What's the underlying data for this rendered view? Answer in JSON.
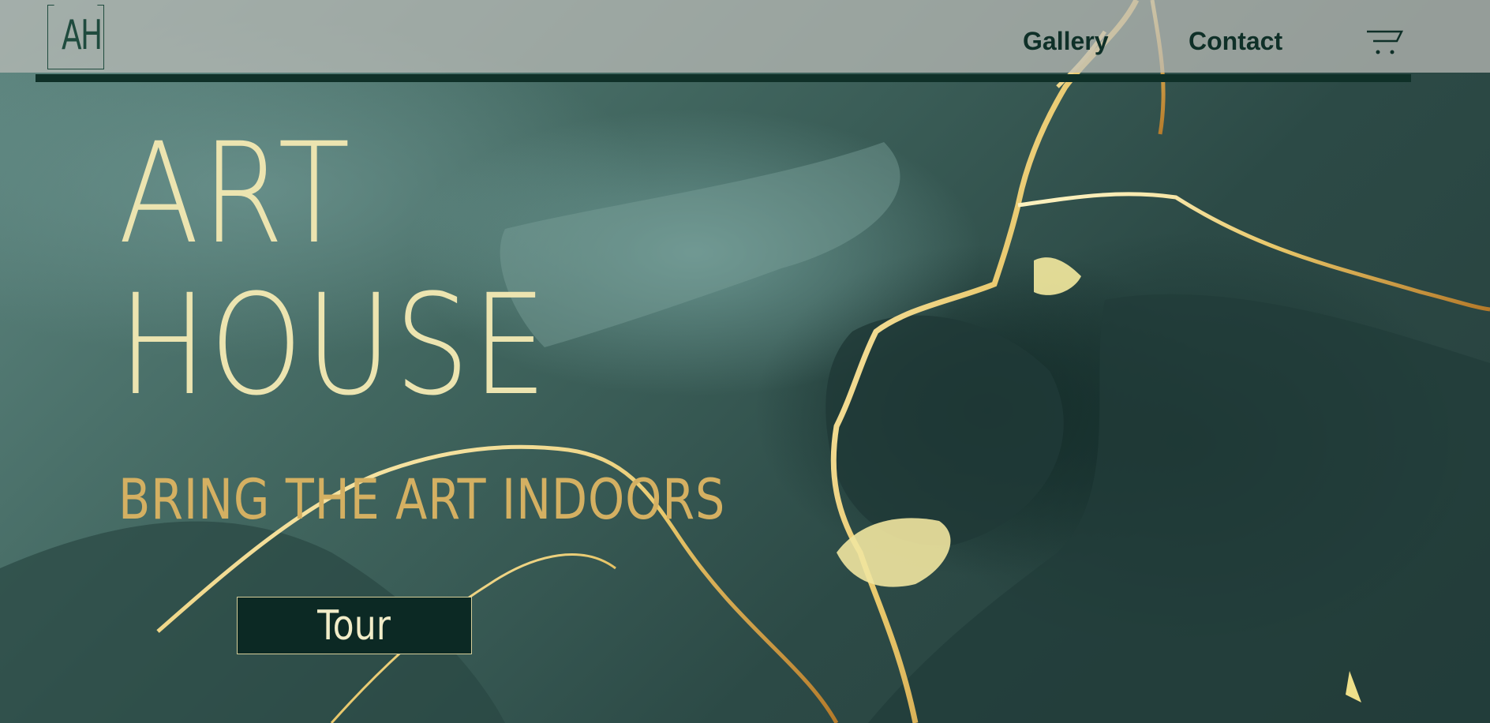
{
  "brand": {
    "logo_text": "AH"
  },
  "nav": {
    "items": [
      {
        "label": "Gallery"
      },
      {
        "label": "Contact"
      }
    ],
    "cart_icon": "cart-icon"
  },
  "hero": {
    "title_line1": "ART",
    "title_line2": "HOUSE",
    "subtitle": "BRING THE ART INDOORS",
    "cta_label": "Tour",
    "background": "green-gold-marble-ink-art"
  },
  "colors": {
    "header_line": "#0f3028",
    "title": "#ece4b0",
    "subtitle": "#d4b062",
    "button_bg": "#0c2924",
    "gold": "#e8c76a"
  }
}
